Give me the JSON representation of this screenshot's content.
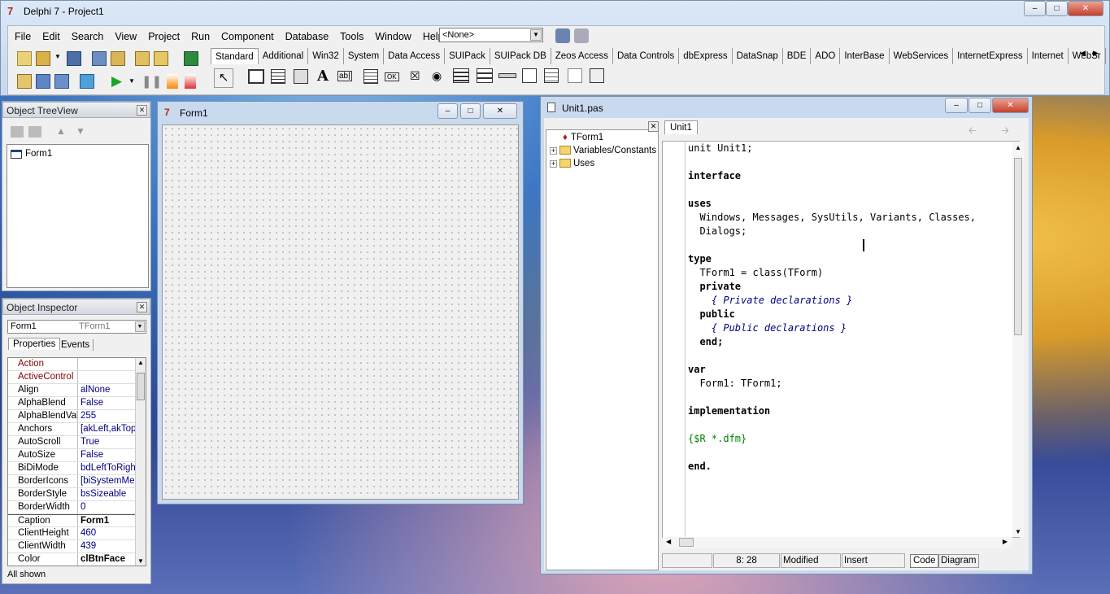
{
  "main_window": {
    "title": "Delphi 7 - Project1",
    "combo_value": "<None>"
  },
  "menu": [
    "File",
    "Edit",
    "Search",
    "View",
    "Project",
    "Run",
    "Component",
    "Database",
    "Tools",
    "Window",
    "Help"
  ],
  "palette_tabs": [
    "Standard",
    "Additional",
    "Win32",
    "System",
    "Data Access",
    "SUIPack",
    "SUIPack DB",
    "Zeos Access",
    "Data Controls",
    "dbExpress",
    "DataSnap",
    "BDE",
    "ADO",
    "InterBase",
    "WebServices",
    "InternetExpress",
    "Internet",
    "WebSr"
  ],
  "tree_view": {
    "title": "Object TreeView",
    "items": [
      "Form1"
    ]
  },
  "inspector": {
    "title": "Object Inspector",
    "object_name": "Form1",
    "object_type": "TForm1",
    "tabs": [
      "Properties",
      "Events"
    ],
    "status": "All shown",
    "rows": [
      {
        "name": "Action",
        "value": "",
        "color": "#800000"
      },
      {
        "name": "ActiveControl",
        "value": "",
        "color": "#800000"
      },
      {
        "name": "Align",
        "value": "alNone"
      },
      {
        "name": "AlphaBlend",
        "value": "False"
      },
      {
        "name": "AlphaBlendValu",
        "value": "255"
      },
      {
        "name": "Anchors",
        "value": "[akLeft,akTop"
      },
      {
        "name": "AutoScroll",
        "value": "True"
      },
      {
        "name": "AutoSize",
        "value": "False"
      },
      {
        "name": "BiDiMode",
        "value": "bdLeftToRight"
      },
      {
        "name": "BorderIcons",
        "value": "[biSystemMen"
      },
      {
        "name": "BorderStyle",
        "value": "bsSizeable"
      },
      {
        "name": "BorderWidth",
        "value": "0"
      },
      {
        "name": "Caption",
        "value": "Form1"
      },
      {
        "name": "ClientHeight",
        "value": "460"
      },
      {
        "name": "ClientWidth",
        "value": "439"
      },
      {
        "name": "Color",
        "value": "clBtnFace"
      }
    ]
  },
  "form": {
    "title": "Form1"
  },
  "editor": {
    "title": "Unit1.pas",
    "tab": "Unit1",
    "explorer": [
      "TForm1",
      "Variables/Constants",
      "Uses"
    ],
    "status": {
      "position": "8:  28",
      "modified": "Modified",
      "mode": "Insert",
      "code_tab": "Code",
      "diagram_tab": "Diagram"
    },
    "lines": [
      {
        "t": "unit Unit1;",
        "c": "n"
      },
      {
        "t": "",
        "c": "n"
      },
      {
        "t": "interface",
        "c": "k"
      },
      {
        "t": "",
        "c": "n"
      },
      {
        "t": "uses",
        "c": "k"
      },
      {
        "t": "  Windows, Messages, SysUtils, Variants, Classes, ",
        "c": "n"
      },
      {
        "t": "  Dialogs;",
        "c": "n"
      },
      {
        "t": "",
        "c": "n"
      },
      {
        "t": "type",
        "c": "k"
      },
      {
        "t": "  TForm1 = class(TForm)",
        "c": "n"
      },
      {
        "t": "  private",
        "c": "k"
      },
      {
        "t": "    { Private declarations }",
        "c": "c"
      },
      {
        "t": "  public",
        "c": "k"
      },
      {
        "t": "    { Public declarations }",
        "c": "c"
      },
      {
        "t": "  end;",
        "c": "k"
      },
      {
        "t": "",
        "c": "n"
      },
      {
        "t": "var",
        "c": "k"
      },
      {
        "t": "  Form1: TForm1;",
        "c": "n"
      },
      {
        "t": "",
        "c": "n"
      },
      {
        "t": "implementation",
        "c": "k"
      },
      {
        "t": "",
        "c": "n"
      },
      {
        "t": "{$R *.dfm}",
        "c": "d"
      },
      {
        "t": "",
        "c": "n"
      },
      {
        "t": "end.",
        "c": "k"
      }
    ]
  }
}
